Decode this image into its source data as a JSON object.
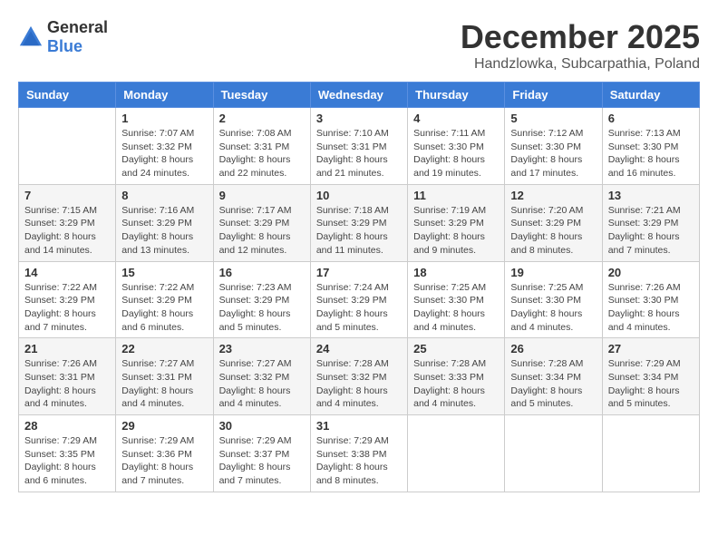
{
  "logo": {
    "text_general": "General",
    "text_blue": "Blue"
  },
  "title": {
    "month_year": "December 2025",
    "location": "Handzlowka, Subcarpathia, Poland"
  },
  "headers": [
    "Sunday",
    "Monday",
    "Tuesday",
    "Wednesday",
    "Thursday",
    "Friday",
    "Saturday"
  ],
  "weeks": [
    [
      {
        "num": "",
        "info": ""
      },
      {
        "num": "1",
        "info": "Sunrise: 7:07 AM\nSunset: 3:32 PM\nDaylight: 8 hours\nand 24 minutes."
      },
      {
        "num": "2",
        "info": "Sunrise: 7:08 AM\nSunset: 3:31 PM\nDaylight: 8 hours\nand 22 minutes."
      },
      {
        "num": "3",
        "info": "Sunrise: 7:10 AM\nSunset: 3:31 PM\nDaylight: 8 hours\nand 21 minutes."
      },
      {
        "num": "4",
        "info": "Sunrise: 7:11 AM\nSunset: 3:30 PM\nDaylight: 8 hours\nand 19 minutes."
      },
      {
        "num": "5",
        "info": "Sunrise: 7:12 AM\nSunset: 3:30 PM\nDaylight: 8 hours\nand 17 minutes."
      },
      {
        "num": "6",
        "info": "Sunrise: 7:13 AM\nSunset: 3:30 PM\nDaylight: 8 hours\nand 16 minutes."
      }
    ],
    [
      {
        "num": "7",
        "info": "Sunrise: 7:15 AM\nSunset: 3:29 PM\nDaylight: 8 hours\nand 14 minutes."
      },
      {
        "num": "8",
        "info": "Sunrise: 7:16 AM\nSunset: 3:29 PM\nDaylight: 8 hours\nand 13 minutes."
      },
      {
        "num": "9",
        "info": "Sunrise: 7:17 AM\nSunset: 3:29 PM\nDaylight: 8 hours\nand 12 minutes."
      },
      {
        "num": "10",
        "info": "Sunrise: 7:18 AM\nSunset: 3:29 PM\nDaylight: 8 hours\nand 11 minutes."
      },
      {
        "num": "11",
        "info": "Sunrise: 7:19 AM\nSunset: 3:29 PM\nDaylight: 8 hours\nand 9 minutes."
      },
      {
        "num": "12",
        "info": "Sunrise: 7:20 AM\nSunset: 3:29 PM\nDaylight: 8 hours\nand 8 minutes."
      },
      {
        "num": "13",
        "info": "Sunrise: 7:21 AM\nSunset: 3:29 PM\nDaylight: 8 hours\nand 7 minutes."
      }
    ],
    [
      {
        "num": "14",
        "info": "Sunrise: 7:22 AM\nSunset: 3:29 PM\nDaylight: 8 hours\nand 7 minutes."
      },
      {
        "num": "15",
        "info": "Sunrise: 7:22 AM\nSunset: 3:29 PM\nDaylight: 8 hours\nand 6 minutes."
      },
      {
        "num": "16",
        "info": "Sunrise: 7:23 AM\nSunset: 3:29 PM\nDaylight: 8 hours\nand 5 minutes."
      },
      {
        "num": "17",
        "info": "Sunrise: 7:24 AM\nSunset: 3:29 PM\nDaylight: 8 hours\nand 5 minutes."
      },
      {
        "num": "18",
        "info": "Sunrise: 7:25 AM\nSunset: 3:30 PM\nDaylight: 8 hours\nand 4 minutes."
      },
      {
        "num": "19",
        "info": "Sunrise: 7:25 AM\nSunset: 3:30 PM\nDaylight: 8 hours\nand 4 minutes."
      },
      {
        "num": "20",
        "info": "Sunrise: 7:26 AM\nSunset: 3:30 PM\nDaylight: 8 hours\nand 4 minutes."
      }
    ],
    [
      {
        "num": "21",
        "info": "Sunrise: 7:26 AM\nSunset: 3:31 PM\nDaylight: 8 hours\nand 4 minutes."
      },
      {
        "num": "22",
        "info": "Sunrise: 7:27 AM\nSunset: 3:31 PM\nDaylight: 8 hours\nand 4 minutes."
      },
      {
        "num": "23",
        "info": "Sunrise: 7:27 AM\nSunset: 3:32 PM\nDaylight: 8 hours\nand 4 minutes."
      },
      {
        "num": "24",
        "info": "Sunrise: 7:28 AM\nSunset: 3:32 PM\nDaylight: 8 hours\nand 4 minutes."
      },
      {
        "num": "25",
        "info": "Sunrise: 7:28 AM\nSunset: 3:33 PM\nDaylight: 8 hours\nand 4 minutes."
      },
      {
        "num": "26",
        "info": "Sunrise: 7:28 AM\nSunset: 3:34 PM\nDaylight: 8 hours\nand 5 minutes."
      },
      {
        "num": "27",
        "info": "Sunrise: 7:29 AM\nSunset: 3:34 PM\nDaylight: 8 hours\nand 5 minutes."
      }
    ],
    [
      {
        "num": "28",
        "info": "Sunrise: 7:29 AM\nSunset: 3:35 PM\nDaylight: 8 hours\nand 6 minutes."
      },
      {
        "num": "29",
        "info": "Sunrise: 7:29 AM\nSunset: 3:36 PM\nDaylight: 8 hours\nand 7 minutes."
      },
      {
        "num": "30",
        "info": "Sunrise: 7:29 AM\nSunset: 3:37 PM\nDaylight: 8 hours\nand 7 minutes."
      },
      {
        "num": "31",
        "info": "Sunrise: 7:29 AM\nSunset: 3:38 PM\nDaylight: 8 hours\nand 8 minutes."
      },
      {
        "num": "",
        "info": ""
      },
      {
        "num": "",
        "info": ""
      },
      {
        "num": "",
        "info": ""
      }
    ]
  ]
}
